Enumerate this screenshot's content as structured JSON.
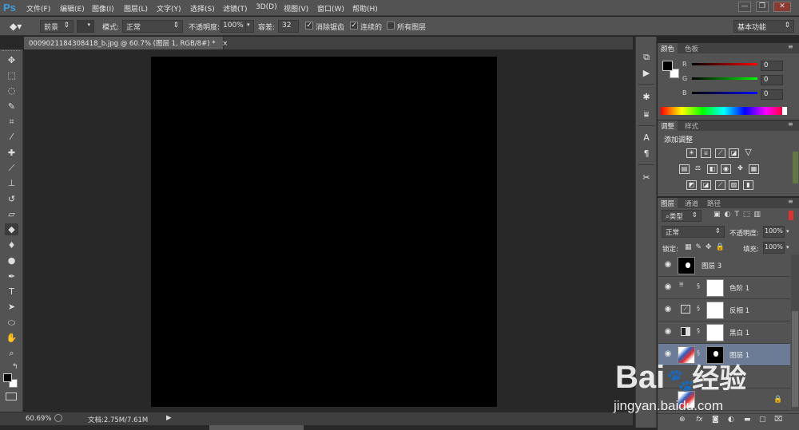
{
  "app": {
    "logo": "Ps",
    "menu": [
      "文件(F)",
      "编辑(E)",
      "图像(I)",
      "图层(L)",
      "文字(Y)",
      "选择(S)",
      "滤镜(T)",
      "3D(D)",
      "视图(V)",
      "窗口(W)",
      "帮助(H)"
    ],
    "window_buttons": [
      "—",
      "❐",
      "✕"
    ]
  },
  "options": {
    "fill_source": "前景",
    "mode_label": "模式:",
    "mode_value": "正常",
    "opacity_label": "不透明度:",
    "opacity_value": "100%",
    "tolerance_label": "容差:",
    "tolerance_value": "32",
    "antialias_label": "消除锯齿",
    "antialias_checked": true,
    "contiguous_label": "连续的",
    "contiguous_checked": true,
    "all_layers_label": "所有图层",
    "all_layers_checked": false,
    "workspace": "基本功能"
  },
  "document": {
    "tab_title": "0009021184308418_b.jpg @ 60.7% (图层 1, RGB/8#) *",
    "canvas_color": "#000000"
  },
  "status": {
    "zoom": "60.69%",
    "doc_info": "文档:2.75M/7.61M"
  },
  "tools": [
    "move-tool",
    "marquee-tool",
    "lasso-tool",
    "quick-select-tool",
    "crop-tool",
    "eyedropper-tool",
    "healing-brush-tool",
    "brush-tool",
    "clone-stamp-tool",
    "history-brush-tool",
    "eraser-tool",
    "paint-bucket-tool",
    "blur-tool",
    "dodge-tool",
    "pen-tool",
    "type-tool",
    "path-select-tool",
    "shape-tool",
    "hand-tool",
    "zoom-tool"
  ],
  "color_panel": {
    "tabs": [
      "颜色",
      "色板"
    ],
    "channels": [
      {
        "label": "R",
        "value": "0",
        "color": "#d02020"
      },
      {
        "label": "G",
        "value": "0",
        "color": "#20b020"
      },
      {
        "label": "B",
        "value": "0",
        "color": "#2040d0"
      }
    ]
  },
  "adjust_panel": {
    "tabs": [
      "调整",
      "样式"
    ],
    "title": "添加调整"
  },
  "layers_panel": {
    "tabs": [
      "图层",
      "通道",
      "路径"
    ],
    "filter_kind": "类型",
    "blend_mode": "正常",
    "opacity_label": "不透明度:",
    "opacity_value": "100%",
    "lock_label": "锁定:",
    "fill_label": "填充:",
    "fill_value": "100%",
    "layers": [
      {
        "name": "图层 3",
        "selected": false
      },
      {
        "name": "色阶 1",
        "selected": false
      },
      {
        "name": "反相 1",
        "selected": false
      },
      {
        "name": "黑白 1",
        "selected": false
      },
      {
        "name": "图层 1",
        "selected": true
      }
    ],
    "footer_icons": [
      "link-icon",
      "fx-icon",
      "mask-icon",
      "adjustment-icon",
      "group-icon",
      "new-layer-icon",
      "trash-icon"
    ]
  },
  "watermark": {
    "brand": "Bai",
    "brand_suffix": "经验",
    "url": "jingyan.baidu.com"
  }
}
